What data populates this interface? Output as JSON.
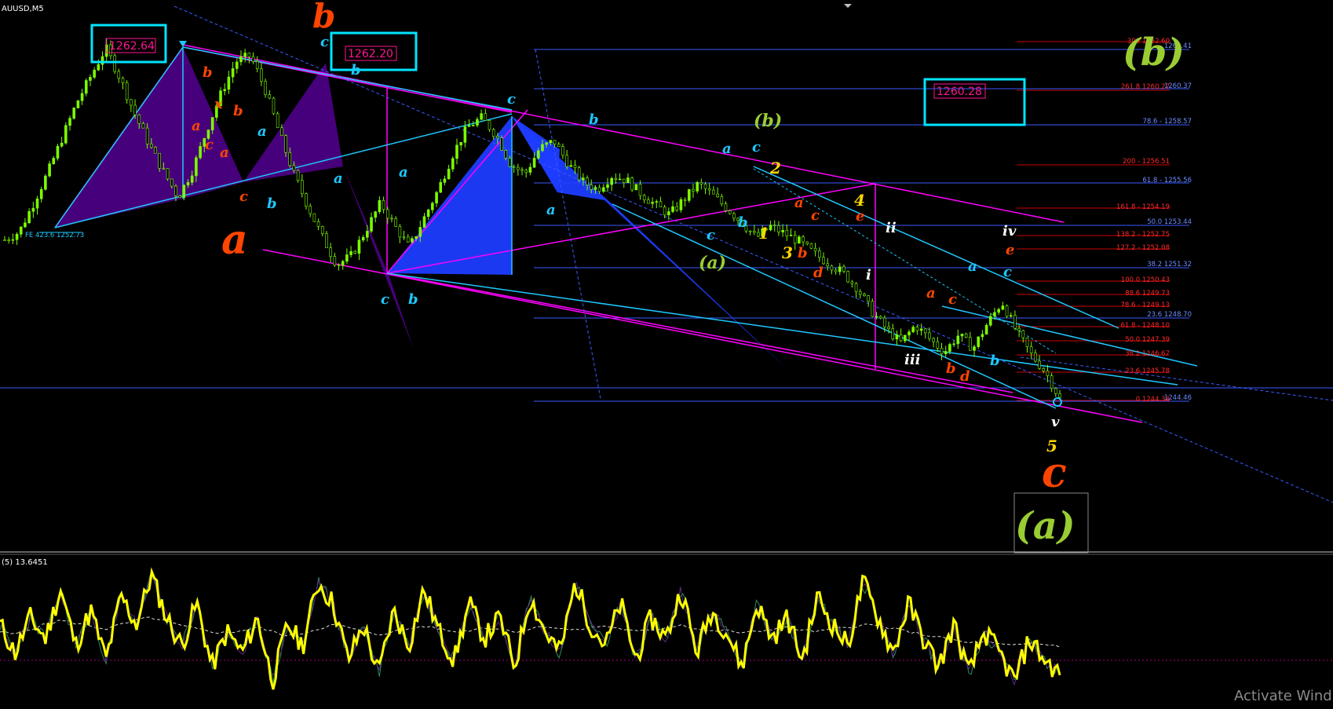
{
  "window": {
    "symbol": "AUUSD,M5",
    "watermark": "Activate Wind"
  },
  "oscillator": {
    "label": "(5) 13.6451"
  },
  "price_boxes": [
    {
      "text": "1262.64"
    },
    {
      "text": "1262.20"
    },
    {
      "text": "1260.28"
    }
  ],
  "fe_label": "FE 423.6 1252.73",
  "fib_blue": [
    {
      "text": "1262.41"
    },
    {
      "text": "1260.37"
    },
    {
      "text": "78.6 - 1258.57"
    },
    {
      "text": "61.8 - 1255.56"
    },
    {
      "text": "50.0 1253.44"
    },
    {
      "text": "38.2 1251.32"
    },
    {
      "text": "23.6 1248.70"
    },
    {
      "text": "1244.46"
    }
  ],
  "fib_red": [
    {
      "text": "300 1262.60"
    },
    {
      "text": "261.8 1260.27"
    },
    {
      "text": "200 - 1256.51"
    },
    {
      "text": "161.8 - 1254.19"
    },
    {
      "text": "138.2 - 1252.75"
    },
    {
      "text": "127.2 - 1252.08"
    },
    {
      "text": "100.0 1250.43"
    },
    {
      "text": "88.6 1249.73"
    },
    {
      "text": "78.6 - 1249.13"
    },
    {
      "text": "61.8 - 1248.10"
    },
    {
      "text": "50.0 1247.39"
    },
    {
      "text": "38.2 1246.67"
    },
    {
      "text": "23.6 1245.78"
    },
    {
      "text": "0 1244.34"
    }
  ],
  "wave_labels": {
    "big_b": "b",
    "big_a": "a",
    "big_c": "c",
    "paren_b_top": "(b)",
    "paren_b": "(b)",
    "paren_a": "(a)",
    "paren_a_box": "(a)",
    "l_b1": "b",
    "l_x": "x",
    "l_b2": "b",
    "l_a1": "a",
    "l_c1": "c",
    "l_a2": "a",
    "l_c2": "c",
    "l_a3": "a",
    "l_b3": "b",
    "l_a4": "a",
    "l_c3": "c",
    "l_b4": "b",
    "l_c4": "c",
    "l_b5": "b",
    "l_a5": "a",
    "l_c5": "c",
    "l_b6": "b",
    "l_a6": "a",
    "l_c6": "c",
    "l_b7": "b",
    "l_c7": "c",
    "l_a7": "a",
    "l_a8": "a",
    "l_c8": "c",
    "l_b8": "b",
    "l_d1": "d",
    "l_b9": "b",
    "l_a9": "a",
    "l_c9": "c",
    "l_d2": "d",
    "l_b10": "b",
    "l_a10": "a",
    "l_c10": "c",
    "l_b11": "b",
    "l_e1": "e",
    "l_e2": "e",
    "n1": "1",
    "n2": "2",
    "n3": "3",
    "n4": "4",
    "n5": "5",
    "r_i": "i",
    "r_ii": "ii",
    "r_iii": "iii",
    "r_iv": "iv",
    "r_v": "v"
  },
  "colors": {
    "background": "#000000",
    "candle": "#7CFC00",
    "magenta": "#FF00FF",
    "cyan": "#1EC8FF",
    "box": "#00E5FF",
    "red_label": "#FF4500",
    "olive": "#9ACD32",
    "yellow": "#FFFF00",
    "purple_fill": "#4B0082",
    "blue_fill": "#1E3CFF",
    "price_text": "#FF1493"
  },
  "chart_data": {
    "type": "candlestick",
    "symbol": "AUUSD",
    "timeframe": "M5",
    "price_series": [
      1252.7,
      1253.1,
      1254.6,
      1256.2,
      1258.0,
      1259.8,
      1261.2,
      1262.6,
      1261.0,
      1259.2,
      1257.6,
      1256.2,
      1254.9,
      1256.3,
      1258.4,
      1260.3,
      1261.9,
      1262.2,
      1260.5,
      1258.2,
      1256.1,
      1254.4,
      1252.8,
      1251.4,
      1251.9,
      1253.2,
      1254.6,
      1253.4,
      1252.3,
      1253.8,
      1255.3,
      1257.1,
      1258.5,
      1259.0,
      1258.1,
      1256.6,
      1256.1,
      1257.4,
      1257.8,
      1256.6,
      1255.7,
      1255.3,
      1256.0,
      1255.8,
      1255.1,
      1254.5,
      1254.0,
      1254.8,
      1255.6,
      1255.0,
      1254.3,
      1253.6,
      1252.8,
      1253.4,
      1253.0,
      1252.6,
      1252.0,
      1251.5,
      1251.0,
      1250.2,
      1249.0,
      1248.1,
      1247.4,
      1248.3,
      1247.6,
      1246.9,
      1247.8,
      1247.1,
      1248.4,
      1249.5,
      1248.0,
      1246.8,
      1245.9,
      1244.5
    ],
    "oscillator_label": "(5) 13.6451",
    "oscillator_series": [
      55,
      35,
      60,
      45,
      80,
      40,
      65,
      30,
      75,
      55,
      90,
      60,
      40,
      70,
      25,
      50,
      35,
      60,
      15,
      55,
      40,
      85,
      70,
      30,
      55,
      20,
      65,
      40,
      80,
      50,
      30,
      70,
      45,
      60,
      25,
      75,
      50,
      35,
      85,
      55,
      40,
      70,
      30,
      60,
      45,
      80,
      35,
      65,
      50,
      25,
      70,
      45,
      60,
      30,
      75,
      55,
      40,
      85,
      60,
      35,
      70,
      45,
      25,
      55,
      20,
      50,
      35,
      15,
      45,
      30,
      20
    ],
    "oscillator_signal": [
      50,
      48,
      52,
      55,
      58,
      56,
      54,
      52,
      55,
      58,
      60,
      57,
      54,
      52,
      50,
      49,
      51,
      53,
      50,
      47,
      49,
      52,
      55,
      53,
      50,
      48,
      50,
      52,
      54,
      52,
      50,
      51,
      53,
      52,
      50,
      52,
      54,
      52,
      51,
      53,
      54,
      52,
      50,
      51,
      53,
      55,
      52,
      50,
      51,
      49,
      50,
      52,
      53,
      51,
      50,
      52,
      53,
      55,
      54,
      52,
      50,
      48,
      46,
      44,
      42,
      43,
      41,
      40,
      42,
      41,
      40
    ]
  }
}
